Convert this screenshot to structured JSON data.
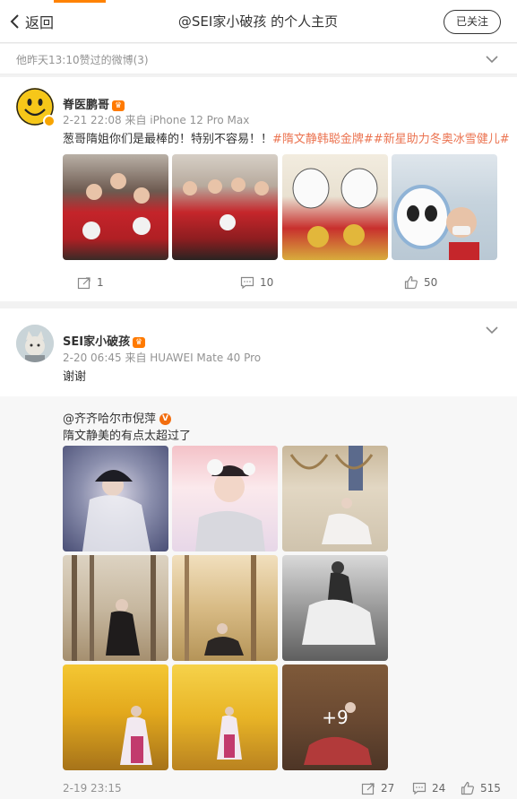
{
  "header": {
    "back_label": "返回",
    "title": "@SEI家小破孩 的个人主页",
    "follow_label": "已关注"
  },
  "liked_bar": {
    "label": "他昨天13:10赞过的微博(3)"
  },
  "post1": {
    "author": "脊医鹏哥",
    "meta": "2-21 22:08 来自 iPhone 12 Pro Max",
    "text_plain": "葱哥隋姐你们是最棒的！特别不容易！！",
    "text_tags": "#隋文静韩聪金牌##新星助力冬奥冰雪健儿#",
    "repost_count": "1",
    "comment_count": "10",
    "like_count": "50"
  },
  "post2": {
    "author": "SEI家小破孩",
    "meta": "2-20 06:45 来自 HUAWEI Mate 40 Pro",
    "text": "谢谢",
    "repost": {
      "author": "@齐齐哈尔市倪萍",
      "text": "隋文静美的有点太超过了",
      "more_images": "+9"
    },
    "footer_time": "2-19 23:15",
    "repost_count": "27",
    "comment_count": "24",
    "like_count": "515"
  },
  "colors": {
    "accent": "#ff8200",
    "tag": "#eb7350",
    "muted": "#939393"
  }
}
